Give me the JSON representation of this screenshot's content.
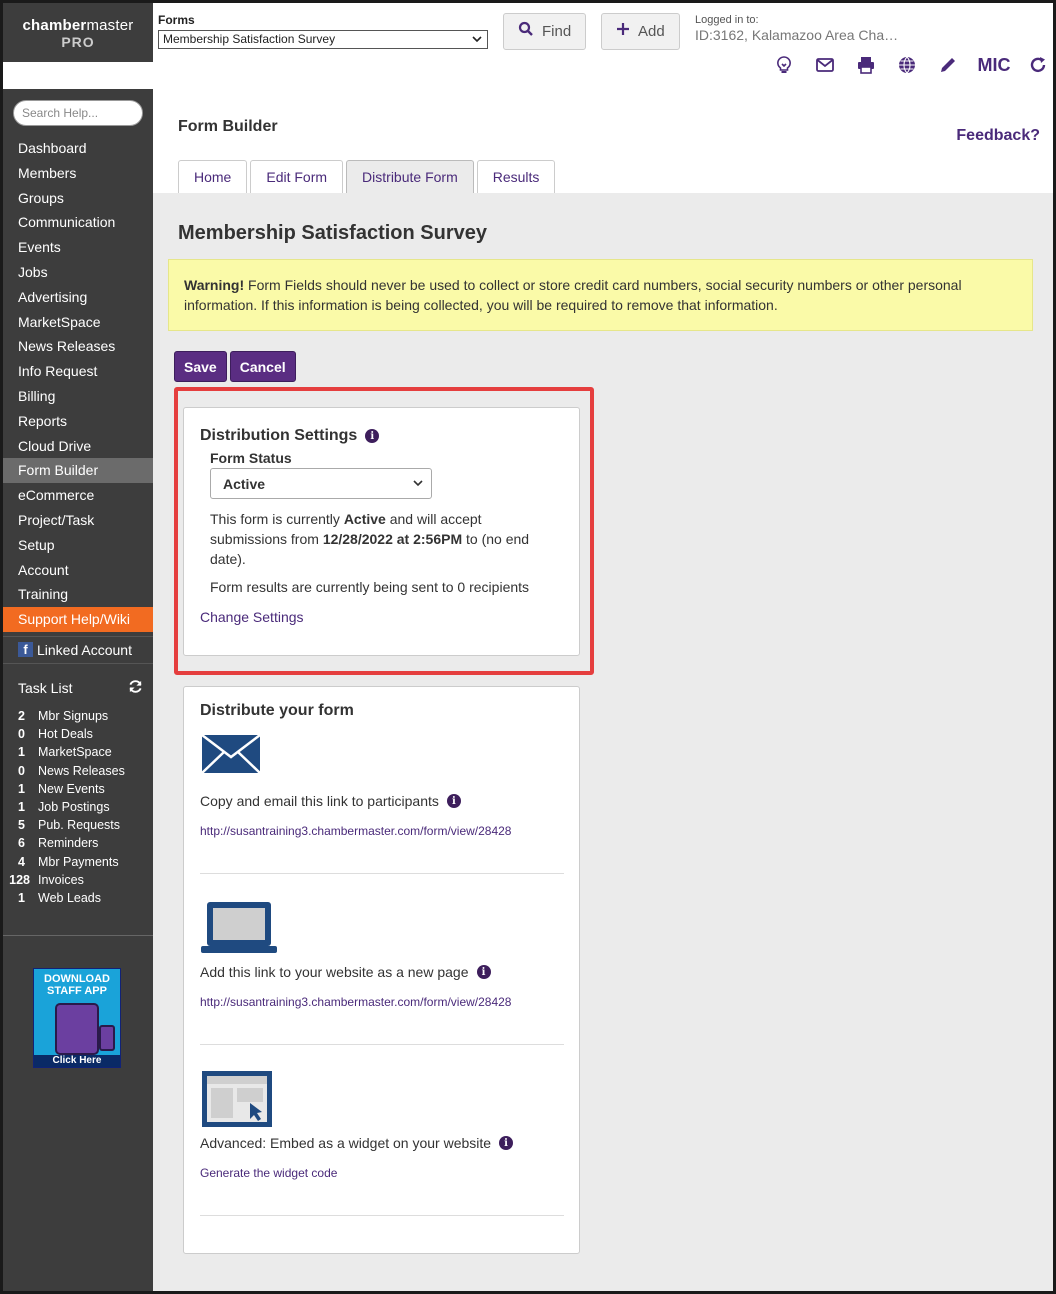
{
  "header": {
    "logo_line1_bold": "chamber",
    "logo_line1_rest": "master",
    "logo_line2": "PRO",
    "forms_label": "Forms",
    "forms_selected": "Membership Satisfaction Survey",
    "find_label": "Find",
    "add_label": "Add",
    "logged_in_label": "Logged in to:",
    "logged_in_org": "ID:3162, Kalamazoo Area Cha…",
    "mic_label": "MIC"
  },
  "sidebar": {
    "search_placeholder": "Search Help...",
    "nav": [
      "Dashboard",
      "Members",
      "Groups",
      "Communication",
      "Events",
      "Jobs",
      "Advertising",
      "MarketSpace",
      "News Releases",
      "Info Request",
      "Billing",
      "Reports",
      "Cloud Drive",
      "Form Builder",
      "eCommerce",
      "Project/Task",
      "Setup",
      "Account",
      "Training",
      "Support Help/Wiki"
    ],
    "active": "Form Builder",
    "linked_account": "Linked Account",
    "task_list_title": "Task List",
    "tasks": [
      {
        "count": "2",
        "label": "Mbr Signups"
      },
      {
        "count": "0",
        "label": "Hot Deals"
      },
      {
        "count": "1",
        "label": "MarketSpace"
      },
      {
        "count": "0",
        "label": "News Releases"
      },
      {
        "count": "1",
        "label": "New Events"
      },
      {
        "count": "1",
        "label": "Job Postings"
      },
      {
        "count": "5",
        "label": "Pub. Requests"
      },
      {
        "count": "6",
        "label": "Reminders"
      },
      {
        "count": "4",
        "label": "Mbr Payments"
      },
      {
        "count": "128",
        "label": "Invoices"
      },
      {
        "count": "1",
        "label": "Web Leads"
      }
    ],
    "promo_line1": "DOWNLOAD",
    "promo_line2": "STAFF APP",
    "promo_click": "Click Here"
  },
  "main": {
    "page_title": "Form Builder",
    "feedback": "Feedback?",
    "tabs": [
      "Home",
      "Edit Form",
      "Distribute Form",
      "Results"
    ],
    "active_tab": "Distribute Form",
    "survey_title": "Membership Satisfaction Survey",
    "warning_bold": "Warning!",
    "warning_text": " Form Fields should never be used to collect or store credit card numbers, social security numbers or other personal information. If this information is being collected, you will be required to remove that information.",
    "save_label": "Save",
    "cancel_label": "Cancel",
    "distribution": {
      "title": "Distribution Settings",
      "form_status_label": "Form Status",
      "form_status_value": "Active",
      "desc_1": "This form is currently ",
      "desc_status": "Active",
      "desc_2": " and will accept submissions from ",
      "desc_date": "12/28/2022 at 2:56PM",
      "desc_3": " to (no end date).",
      "recipients": "Form results are currently being sent to 0 recipients",
      "change_settings": "Change Settings"
    },
    "distribute": {
      "title": "Distribute your form",
      "items": [
        {
          "label": "Copy and email this link to participants",
          "link": "http://susantraining3.chambermaster.com/form/view/28428"
        },
        {
          "label": "Add this link to your website as a new page",
          "link": "http://susantraining3.chambermaster.com/form/view/28428"
        },
        {
          "label": "Advanced: Embed as a widget on your website",
          "link": "Generate the widget code"
        }
      ]
    }
  },
  "colors": {
    "brand_purple": "#4a2a7a",
    "button_purple": "#5a2d82",
    "sidebar_bg": "#3d3d3d",
    "support_orange": "#f26b21",
    "warning_bg": "#fafaa8",
    "highlight_red": "#e53e3e"
  }
}
